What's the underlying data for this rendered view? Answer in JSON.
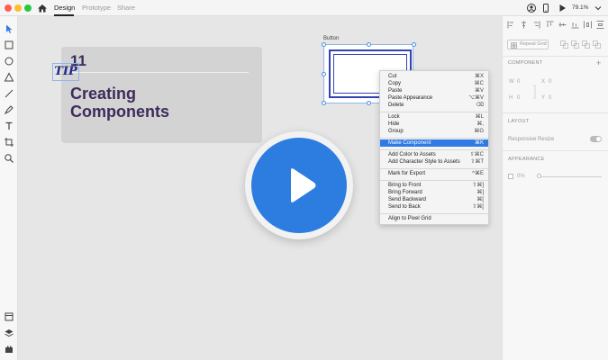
{
  "titlebar": {
    "tabs": [
      {
        "label": "Design",
        "active": true
      },
      {
        "label": "Prototype",
        "active": false
      },
      {
        "label": "Share",
        "active": false
      }
    ],
    "zoom": "79.1%"
  },
  "card": {
    "number": "11",
    "title_line1": "Creating",
    "title_line2": "Components"
  },
  "artboard": {
    "label": "Button",
    "text": "TIP"
  },
  "context_menu": {
    "items": [
      {
        "label": "Cut",
        "shortcut": "⌘X"
      },
      {
        "label": "Copy",
        "shortcut": "⌘C"
      },
      {
        "label": "Paste",
        "shortcut": "⌘V"
      },
      {
        "label": "Paste Appearance",
        "shortcut": "⌥⌘V"
      },
      {
        "label": "Delete",
        "shortcut": "⌫"
      },
      {
        "label": "Lock",
        "shortcut": "⌘L"
      },
      {
        "label": "Hide",
        "shortcut": "⌘,"
      },
      {
        "label": "Group",
        "shortcut": "⌘G"
      },
      {
        "label": "Make Component",
        "shortcut": "⌘K",
        "highlighted": true
      },
      {
        "label": "Add Color to Assets",
        "shortcut": "⇧⌘C"
      },
      {
        "label": "Add Character Style to Assets",
        "shortcut": "⇧⌘T"
      },
      {
        "label": "Mark for Export",
        "shortcut": "^⌘E"
      },
      {
        "label": "Bring to Front",
        "shortcut": "⇧⌘]"
      },
      {
        "label": "Bring Forward",
        "shortcut": "⌘]"
      },
      {
        "label": "Send Backward",
        "shortcut": "⌘["
      },
      {
        "label": "Send to Back",
        "shortcut": "⇧⌘["
      },
      {
        "label": "Align to Pixel Grid",
        "shortcut": ""
      }
    ]
  },
  "right_panel": {
    "repeat_grid": "Repeat Grid",
    "component_label": "COMPONENT",
    "w_label": "W",
    "w_value": "0",
    "x_label": "X",
    "x_value": "0",
    "h_label": "H",
    "h_value": "0",
    "y_label": "Y",
    "y_value": "0",
    "layout_label": "LAYOUT",
    "responsive_resize": "Responsive Resize",
    "appearance_label": "APPEARANCE",
    "opacity": "0%",
    "add_symbol": "+"
  },
  "colors": {
    "accent": "#2f7ae5",
    "play": "#2d7de0",
    "title_purple": "#3e2b5c",
    "button_blue": "#3244b5"
  }
}
